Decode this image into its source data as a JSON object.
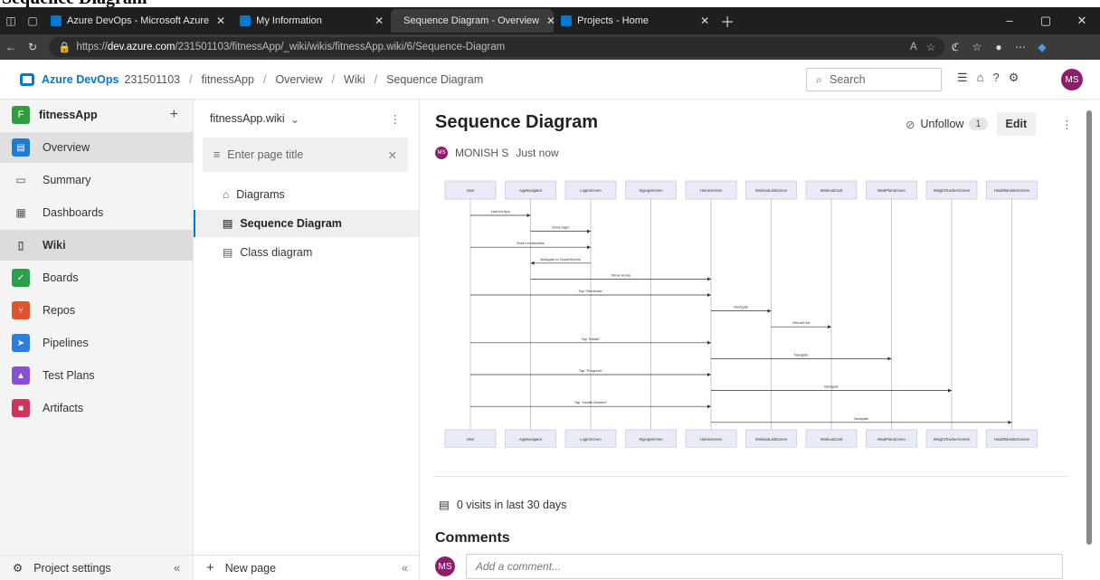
{
  "doc_title": "Sequence Diagram",
  "browser": {
    "tabs": [
      {
        "label": "Azure DevOps - Microsoft Azure",
        "color": "#0078d4",
        "active": false
      },
      {
        "label": "My Information",
        "color": "#0078d4",
        "active": false
      },
      {
        "label": "Sequence Diagram - Overview",
        "color": "#0078d4",
        "active": true
      },
      {
        "label": "Projects - Home",
        "color": "#0078d4",
        "active": false
      }
    ],
    "url_prefix": "https://",
    "url_host": "dev.azure.com",
    "url_path": "/231501103/fitnessApp/_wiki/wikis/fitnessApp.wiki/6/Sequence-Diagram"
  },
  "header": {
    "brand": "Azure DevOps",
    "org": "231501103",
    "crumbs": [
      "fitnessApp",
      "Overview",
      "Wiki",
      "Sequence Diagram"
    ],
    "search_placeholder": "Search",
    "avatar": "MS"
  },
  "leftnav": {
    "project_initial": "F",
    "project": "fitnessApp",
    "items": [
      {
        "label": "Overview",
        "icon": "overview-icon",
        "color": "#1f7bd1"
      },
      {
        "label": "Summary",
        "icon": "summary-icon",
        "color": ""
      },
      {
        "label": "Dashboards",
        "icon": "dashboards-icon",
        "color": ""
      },
      {
        "label": "Wiki",
        "icon": "wiki-icon",
        "color": ""
      },
      {
        "label": "Boards",
        "icon": "boards-icon",
        "color": "#2aa148"
      },
      {
        "label": "Repos",
        "icon": "repos-icon",
        "color": "#e0532c"
      },
      {
        "label": "Pipelines",
        "icon": "pipelines-icon",
        "color": "#2a7de1"
      },
      {
        "label": "Test Plans",
        "icon": "test-plans-icon",
        "color": "#8a4fd6"
      },
      {
        "label": "Artifacts",
        "icon": "artifacts-icon",
        "color": "#d1345b"
      }
    ],
    "settings": "Project settings"
  },
  "tree": {
    "wiki_name": "fitnessApp.wiki",
    "title_placeholder": "Enter page title",
    "pages": [
      "Diagrams",
      "Sequence Diagram",
      "Class diagram"
    ],
    "new_page": "New page"
  },
  "main": {
    "title": "Sequence Diagram",
    "unfollow": "Unfollow",
    "follow_count": "1",
    "edit": "Edit",
    "author": "MONISH S",
    "time": "Just now",
    "visits": "0 visits in last 30 days",
    "comments_heading": "Comments",
    "comment_placeholder": "Add a comment...",
    "comment_avatar": "MS"
  },
  "diagram": {
    "participants": [
      "User",
      "AppNavigator",
      "LoginScreen",
      "SignupScreen",
      "HomeScreen",
      "WorkoutListScreen",
      "WorkoutCard",
      "MealPlanScreen",
      "WeightTrackerScreen",
      "HealthMonitorScreen"
    ],
    "messages": [
      {
        "from": 0,
        "to": 1,
        "label": "Launch App"
      },
      {
        "from": 1,
        "to": 2,
        "label": "Show login"
      },
      {
        "from": 0,
        "to": 2,
        "label": "Enter credentials"
      },
      {
        "from": 2,
        "to": 1,
        "label": "Navigate to HomeScreen"
      },
      {
        "from": 1,
        "to": 4,
        "label": "Show Home"
      },
      {
        "from": 0,
        "to": 4,
        "label": "Tap \"Workouts\""
      },
      {
        "from": 4,
        "to": 5,
        "label": "Navigate"
      },
      {
        "from": 5,
        "to": 6,
        "label": "Render list"
      },
      {
        "from": 0,
        "to": 4,
        "label": "Tap \"Meals\""
      },
      {
        "from": 4,
        "to": 7,
        "label": "Navigate"
      },
      {
        "from": 0,
        "to": 4,
        "label": "Tap \"Progress\""
      },
      {
        "from": 4,
        "to": 8,
        "label": "Navigate"
      },
      {
        "from": 0,
        "to": 4,
        "label": "Tap \"Health Monitor\""
      },
      {
        "from": 4,
        "to": 9,
        "label": "Navigate"
      }
    ]
  }
}
